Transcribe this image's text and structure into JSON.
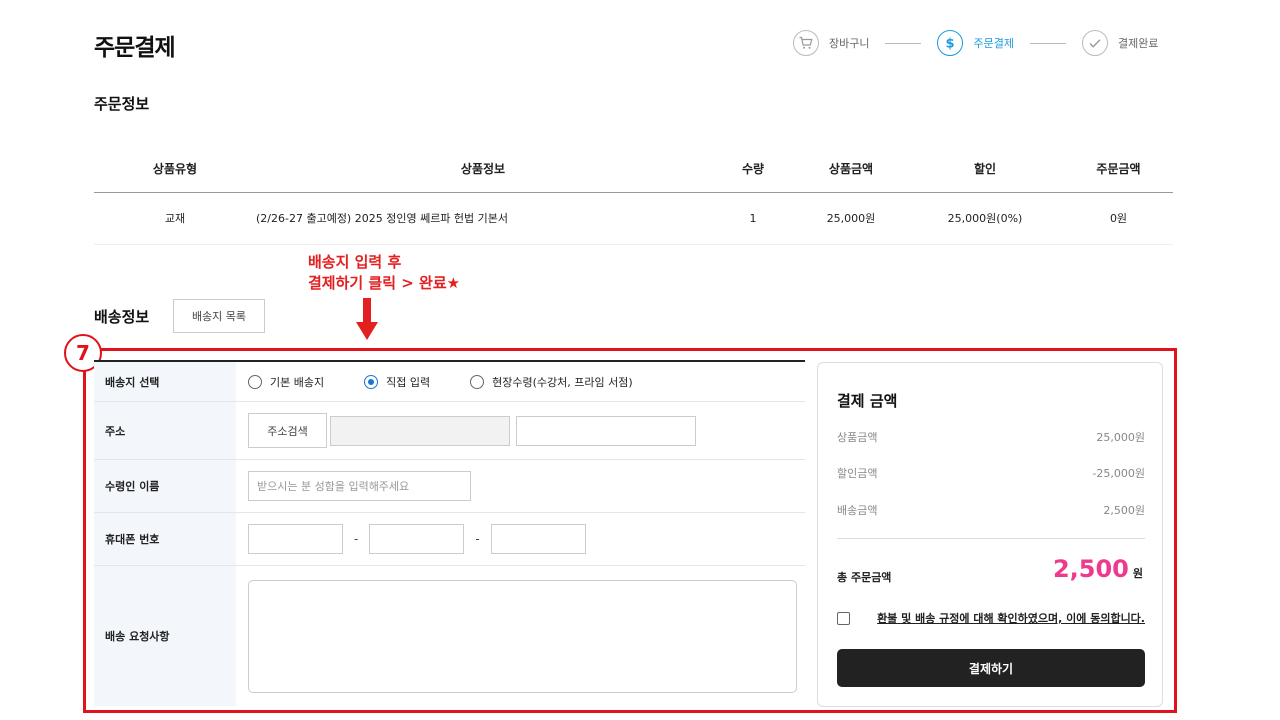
{
  "page": {
    "title": "주문결제"
  },
  "stepper": {
    "steps": [
      {
        "label": "장바구니",
        "icon": "cart-icon"
      },
      {
        "label": "주문결제",
        "icon": "dollar-icon",
        "active": true
      },
      {
        "label": "결제완료",
        "icon": "check-icon"
      }
    ]
  },
  "order_info": {
    "title": "주문정보",
    "columns": [
      "상품유형",
      "상품정보",
      "수량",
      "상품금액",
      "할인",
      "주문금액"
    ],
    "rows": [
      {
        "type": "교재",
        "info": "(2/26-27 출고예정) 2025 정인영 쎄르파 헌법 기본서",
        "qty": "1",
        "price": "25,000원",
        "discount": "25,000원(0%)",
        "total": "0원"
      }
    ]
  },
  "annotation": {
    "line1": "배송지 입력 후",
    "line2": "결제하기 클릭 > 완료★",
    "step_number": "7",
    "color": "#e0121b"
  },
  "shipping": {
    "title": "배송정보",
    "address_list_button": "배송지 목록",
    "labels": {
      "select": "배송지 선택",
      "address": "주소",
      "name": "수령인 이름",
      "phone": "휴대폰 번호",
      "memo": "배송 요청사항"
    },
    "options": [
      "기본 배송지",
      "직접 입력",
      "현장수령(수강처, 프라임 서점)"
    ],
    "selected_option": "직접 입력",
    "address_search_button": "주소검색",
    "name_placeholder": "받으시는 분 성함을 입력해주세요",
    "phone_separator": "-"
  },
  "payment": {
    "title": "결제 금액",
    "rows": [
      {
        "label": "상품금액",
        "value": "25,000원"
      },
      {
        "label": "할인금액",
        "value": "-25,000원"
      },
      {
        "label": "배송금액",
        "value": "2,500원"
      }
    ],
    "total_label": "총 주문금액",
    "total_value": "2,500",
    "total_unit": "원",
    "total_color": "#ee3a8c",
    "agree_text": "환불 및 배송 규정에 대해 확인하였으며, 이에 동의합니다.",
    "pay_button": "결제하기"
  }
}
